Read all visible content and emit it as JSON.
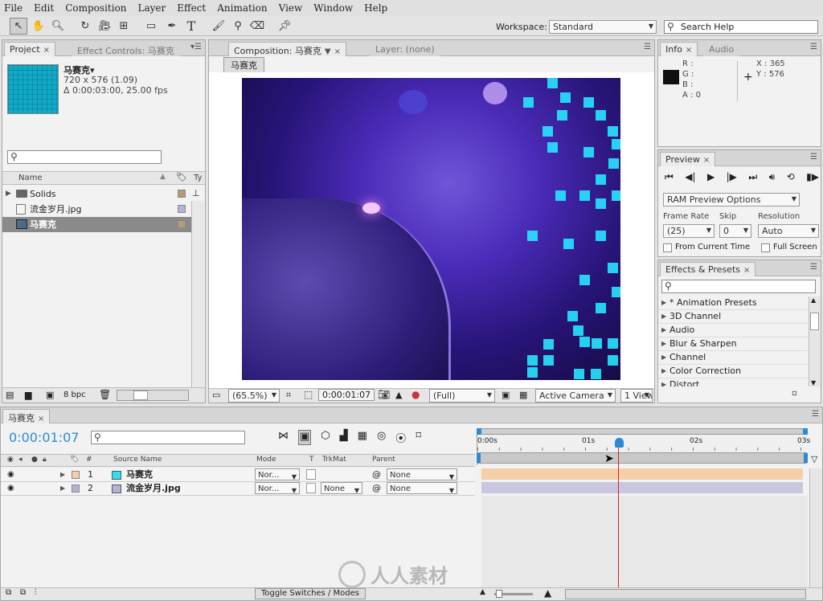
{
  "menu": [
    "File",
    "Edit",
    "Composition",
    "Layer",
    "Effect",
    "Animation",
    "View",
    "Window",
    "Help"
  ],
  "toolbar": {
    "workspace_label": "Workspace:",
    "workspace_value": "Standard",
    "search_placeholder": "Search Help"
  },
  "project": {
    "tab_project": "Project",
    "tab_effect_controls": "Effect Controls: 马赛克",
    "comp_name": "马赛克▾",
    "comp_size": "720 x 576 (1.09)",
    "comp_duration": "Δ 0:00:03:00, 25.00 fps",
    "col_name": "Name",
    "col_type": "Ty",
    "items": [
      "Solids",
      "流金岁月.jpg",
      "马赛克"
    ],
    "bpc": "8 bpc"
  },
  "viewer": {
    "tab_comp": "Composition: 马赛克",
    "tab_layer": "Layer: (none)",
    "crumb": "马赛克",
    "zoom": "(65.5%)",
    "timecode": "0:00:01:07",
    "resolution": "(Full)",
    "camera": "Active Camera",
    "views": "1 View"
  },
  "info": {
    "tab_info": "Info",
    "tab_audio": "Audio",
    "r": "R :",
    "g": "G :",
    "b": "B :",
    "a": "A : 0",
    "x": "X : 365",
    "y": "Y : 576"
  },
  "preview": {
    "tab": "Preview",
    "ram": "RAM Preview Options",
    "frame_rate_label": "Frame Rate",
    "frame_rate": "(25)",
    "skip_label": "Skip",
    "skip": "0",
    "resolution_label": "Resolution",
    "resolution": "Auto",
    "from_current": "From Current Time",
    "full_screen": "Full Screen"
  },
  "effects": {
    "tab": "Effects & Presets",
    "items": [
      "* Animation Presets",
      "3D Channel",
      "Audio",
      "Blur & Sharpen",
      "Channel",
      "Color Correction",
      "Distort"
    ]
  },
  "timeline": {
    "tab": "马赛克",
    "timecode": "0:00:01:07",
    "col_num": "#",
    "col_source": "Source Name",
    "col_mode": "Mode",
    "col_t": "T",
    "col_trkmat": "TrkMat",
    "col_parent": "Parent",
    "ruler": [
      "0:00s",
      "01s",
      "02s",
      "03s"
    ],
    "layers": [
      {
        "num": "1",
        "name": "马赛克",
        "mode": "Nor...",
        "trkmat": "",
        "parent": "None"
      },
      {
        "num": "2",
        "name": "流金岁月.jpg",
        "mode": "Nor...",
        "trkmat": "None",
        "parent": "None"
      }
    ],
    "toggle": "Toggle Switches / Modes"
  },
  "watermark": "人人素材"
}
